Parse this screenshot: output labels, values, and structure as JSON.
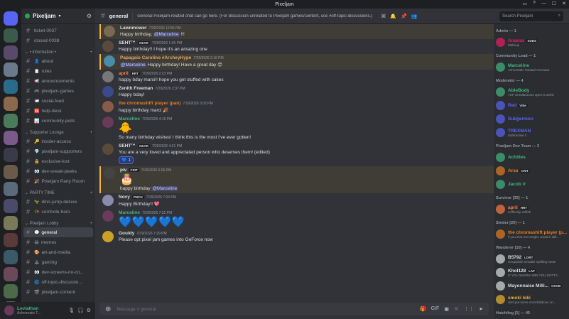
{
  "window": {
    "title": "Pixeljam"
  },
  "guild": {
    "name": "Pixeljam"
  },
  "channels": {
    "top": [
      {
        "label": "ticket-0037"
      },
      {
        "label": "closed-0038"
      }
    ],
    "cat_info": "information",
    "info": [
      {
        "emoji": "👤",
        "label": "about"
      },
      {
        "emoji": "📋",
        "label": "rules"
      },
      {
        "emoji": "📢",
        "label": "announcements"
      },
      {
        "emoji": "🎮",
        "label": "pixeljam-games"
      },
      {
        "emoji": "📨",
        "label": "social-feed"
      },
      {
        "emoji": "🆘",
        "label": "help-desk"
      },
      {
        "emoji": "📊",
        "label": "community-polls"
      }
    ],
    "cat_supporter": "Supporter Lounge",
    "supporter": [
      {
        "emoji": "🔑",
        "label": "insider-access"
      },
      {
        "emoji": "💎",
        "label": "pixeljam-supporters"
      },
      {
        "emoji": "🔒",
        "label": "exclusive-loot"
      },
      {
        "emoji": "👀",
        "label": "dev-sneak-peeks"
      },
      {
        "emoji": "🎉",
        "label": "Pixeljam Party Room"
      }
    ],
    "cat_party": "PARTY TIME",
    "party": [
      {
        "emoji": "🦖",
        "label": "dino-jump-deluxe"
      },
      {
        "emoji": "📯",
        "label": "cornhole-hero"
      }
    ],
    "cat_lobby": "Pixeljam Lobby",
    "lobby": [
      {
        "emoji": "💬",
        "label": "general"
      },
      {
        "emoji": "😂",
        "label": "memes"
      },
      {
        "emoji": "🎨",
        "label": "art-and-media"
      },
      {
        "emoji": "🕹",
        "label": "gaming"
      },
      {
        "emoji": "👀",
        "label": "dev-screens-no-co..."
      },
      {
        "emoji": "🌀",
        "label": "off-topic-discussio..."
      },
      {
        "emoji": "🎬",
        "label": "pixeljam-content"
      }
    ]
  },
  "user": {
    "name": "Leviathan",
    "status": "Achromatic T..."
  },
  "header": {
    "channel": "general",
    "topic": "General Pixeljam-related chat can go here. (For discussion unrelated to Pixeljam games/content, use #off-topic-discussions.)",
    "search_placeholder": "Search Pixeljam"
  },
  "messages": [
    {
      "name": "Lawnmower",
      "color": "#dbdee1",
      "tag": "",
      "ts": "7/29/2026 12:55 PM",
      "text_pre": "Happy birthday, ",
      "mention": "@Marceline",
      "text_post": " !!!",
      "highlight": true,
      "avatar": "#7a6a55"
    },
    {
      "name": "SEHT™",
      "color": "#dbdee1",
      "tag": "GEAR",
      "ts": "7/29/2026 1:05 PM",
      "text_pre": "Happy birthday!! I hope it's an amazing one",
      "mention": "",
      "text_post": "",
      "highlight": false,
      "avatar": "#5a4a3a"
    },
    {
      "name": "Papagaio Carolino #ArcheyHype",
      "color": "#e0a46a",
      "tag": "",
      "ts": "7/29/2026 2:16 PM",
      "text_pre": "",
      "mention": "@Marceline",
      "text_post": " Happy birthday! Have a great day 😊",
      "highlight": true,
      "avatar": "#4a8aaa"
    },
    {
      "name": "april",
      "color": "#ff7a45",
      "tag": "HRT",
      "ts": "7/29/2026 2:23 PM",
      "text_pre": "happy bday marci!! hope you get stuffed with cakes",
      "mention": "",
      "text_post": "",
      "highlight": false,
      "avatar": "#777"
    },
    {
      "name": "Zenith Freeman",
      "color": "#dbdee1",
      "tag": "",
      "ts": "7/29/2026 2:37 PM",
      "text_pre": "Happy bday!",
      "mention": "",
      "text_post": "",
      "highlight": false,
      "avatar": "#3a4a8a"
    },
    {
      "name": "the chromashift player (pan)",
      "color": "#e67e22",
      "tag": "",
      "ts": "7/29/2026 3:02 PM",
      "text_pre": "happy birthday marci 🎉",
      "mention": "",
      "text_post": "",
      "highlight": false,
      "avatar": "#8a5a4a"
    },
    {
      "name": "Marceline",
      "color": "#43b581",
      "tag": "",
      "ts": "7/29/2026 4:19 PM",
      "text_pre": "So many birthday wishes! I think this is the most I've ever gotten!",
      "mention": "",
      "text_post": "",
      "highlight": false,
      "avatar": "#6a3a5a",
      "sticker": "🐥"
    },
    {
      "name": "SEHT™",
      "color": "#dbdee1",
      "tag": "GEAR",
      "ts": "7/29/2026 4:51 PM",
      "text_pre": "You are a very loved and appreciated person who deserves them!",
      "mention": "",
      "text_post": " (edited)",
      "highlight": false,
      "avatar": "#5a4a3a",
      "reaction": "💙",
      "reaction_count": "1"
    },
    {
      "name": "piv",
      "color": "#dbdee1",
      "tag": "CRIT",
      "ts": "7/29/2026 5:06 PM",
      "text_pre": "happy birthday ",
      "mention": "@Marceline",
      "text_post": "",
      "highlight": true,
      "avatar": "#444",
      "sticker": "🎂"
    },
    {
      "name": "Novy",
      "color": "#dbdee1",
      "tag": "PNCH",
      "ts": "7/29/2026 7:04 PM",
      "text_pre": "Happy Birthday!! 💖",
      "mention": "",
      "text_post": "",
      "highlight": false,
      "avatar": "#8a8aaa"
    },
    {
      "name": "Marceline",
      "color": "#43b581",
      "tag": "",
      "ts": "7/29/2026 7:22 PM",
      "text_pre": "",
      "mention": "",
      "text_post": "",
      "highlight": false,
      "avatar": "#6a3a5a",
      "hearts": "💙💙💙💙💙"
    },
    {
      "name": "Gouldy",
      "color": "#dbdee1",
      "tag": "",
      "ts": "7/29/2026 7:29 PM",
      "text_pre": "Please opt pixel jam games into GeForce now",
      "mention": "",
      "text_post": "",
      "highlight": false,
      "avatar": "#c9a227"
    }
  ],
  "composer": {
    "placeholder": "Message # general"
  },
  "members": [
    {
      "group": "Admin — 1",
      "items": [
        {
          "name": "Ananas",
          "status": "Makeup",
          "color": "#e91e63",
          "badge": "SUDS"
        }
      ]
    },
    {
      "group": "Community Lead — 1",
      "items": [
        {
          "name": "Marceline",
          "status": "Achromatic Twisted Aeronaut",
          "color": "#43b581",
          "badge": ""
        }
      ]
    },
    {
      "group": "Moderator — 4",
      "items": [
        {
          "name": "AbleBody",
          "status": "TCP simultaneous open is weird",
          "color": "#43b581",
          "badge": ""
        },
        {
          "name": "Red",
          "status": "",
          "color": "#5865f2",
          "badge": "Vibe"
        },
        {
          "name": "Subjjermon",
          "status": "",
          "color": "#5865f2",
          "badge": ""
        },
        {
          "name": "TREXMAN",
          "status": "Subtractive 2",
          "color": "#5865f2",
          "badge": ""
        }
      ]
    },
    {
      "group": "Pixeljam Dev Team — 3",
      "items": [
        {
          "name": "Achilles",
          "status": "",
          "color": "#43b581",
          "badge": ""
        },
        {
          "name": "Arsa",
          "status": "",
          "color": "#e67e22",
          "badge": "CRIT"
        },
        {
          "name": "Jacob V",
          "status": "",
          "color": "#43b581",
          "badge": ""
        }
      ]
    },
    {
      "group": "Survivor [35] — 1",
      "items": [
        {
          "name": "april",
          "status": "selflessly selfish",
          "color": "#ff7a45",
          "badge": "HRT"
        }
      ]
    },
    {
      "group": "Strider [20] — 1",
      "items": [
        {
          "name": "the chromashift player (p...",
          "status": "if you shot me tonight, would it still...",
          "color": "#e67e22",
          "badge": ""
        }
      ]
    },
    {
      "group": "Wanderer [10] — 4",
      "items": [
        {
          "name": "B5792",
          "status": "scrupuloid versatile spelling mean",
          "color": "#dbdee1",
          "badge": "LORT"
        },
        {
          "name": "Khol128",
          "status": "IF YOU WANNA WIN YOU GOTTA...",
          "color": "#dbdee1",
          "badge": "LAF"
        },
        {
          "name": "Mayonnaise Milli...",
          "status": "",
          "color": "#dbdee1",
          "badge": "CRAB"
        },
        {
          "name": "smoki loki",
          "status": "dont put some crunchatitious on...",
          "color": "#f0b232",
          "badge": ""
        }
      ]
    },
    {
      "group": "Hatchling [1] — 45",
      "items": [
        {
          "name": "[AFJ]some guy [ZSHAQ]",
          "status": "",
          "color": "#dbdee1",
          "badge": ""
        }
      ]
    }
  ],
  "colors": {
    "accent": "#5865f2",
    "mention": "#f0b232",
    "online": "#23a55a"
  }
}
